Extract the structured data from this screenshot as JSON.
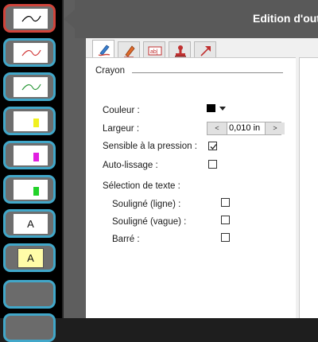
{
  "window": {
    "title": "Edition d'outil"
  },
  "tools": [
    {
      "name": "pen-black",
      "color": "#000000",
      "selected": true
    },
    {
      "name": "pen-red",
      "color": "#d23a3a"
    },
    {
      "name": "pen-green",
      "color": "#2e9a3c"
    },
    {
      "name": "highlighter-yellow",
      "color": "#f0f020"
    },
    {
      "name": "highlighter-magenta",
      "color": "#e020e0"
    },
    {
      "name": "highlighter-green",
      "color": "#22d22a"
    },
    {
      "name": "text-tool",
      "letter": "A"
    },
    {
      "name": "text-highlight-tool",
      "letter": "A"
    }
  ],
  "tabs": [
    {
      "icon": "pen-icon",
      "active": true
    },
    {
      "icon": "highlighter-icon"
    },
    {
      "icon": "text-field-icon"
    },
    {
      "icon": "stamp-icon"
    },
    {
      "icon": "arrow-icon"
    }
  ],
  "crayon": {
    "section_title": "Crayon",
    "color_label": "Couleur :",
    "color_value": "#000000",
    "width_label": "Largeur :",
    "width_value": "0,010 in",
    "width_decrement": "<",
    "width_increment": ">",
    "pressure_label": "Sensible à la pression :",
    "pressure_checked": true,
    "smoothing_label": "Auto-lissage :",
    "smoothing_checked": false,
    "text_selection_label": "Sélection de texte :",
    "underline_line_label": "Souligné (ligne) :",
    "underline_line_checked": false,
    "underline_wave_label": "Souligné (vague) :",
    "underline_wave_checked": false,
    "strike_label": "Barré :",
    "strike_checked": false
  }
}
